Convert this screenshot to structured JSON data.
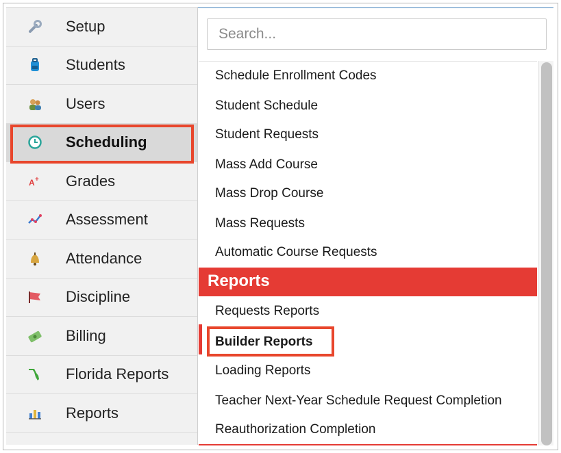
{
  "sidebar": {
    "items": [
      {
        "label": "Setup",
        "icon": "wrench-icon"
      },
      {
        "label": "Students",
        "icon": "backpack-icon"
      },
      {
        "label": "Users",
        "icon": "users-icon"
      },
      {
        "label": "Scheduling",
        "icon": "clock-icon"
      },
      {
        "label": "Grades",
        "icon": "grade-icon"
      },
      {
        "label": "Assessment",
        "icon": "trend-icon"
      },
      {
        "label": "Attendance",
        "icon": "bell-icon"
      },
      {
        "label": "Discipline",
        "icon": "flag-icon"
      },
      {
        "label": "Billing",
        "icon": "money-icon"
      },
      {
        "label": "Florida Reports",
        "icon": "florida-icon"
      },
      {
        "label": "Reports",
        "icon": "bar-chart-icon"
      }
    ],
    "active": "Scheduling"
  },
  "search": {
    "placeholder": "Search..."
  },
  "menu": {
    "items": [
      "Schedule Enrollment Codes",
      "Student Schedule",
      "Student Requests",
      "Mass Add Course",
      "Mass Drop Course",
      "Mass Requests",
      "Automatic Course Requests"
    ],
    "reports_header": "Reports",
    "report_items": [
      "Requests Reports",
      "Builder Reports",
      "Loading Reports",
      "Teacher Next-Year Schedule Request Completion",
      "Reauthorization Completion"
    ],
    "selected": "Builder Reports"
  },
  "colors": {
    "highlight": "#e8462c",
    "section_header": "#e53b34",
    "sidebar_bg": "#f1f1f1"
  }
}
